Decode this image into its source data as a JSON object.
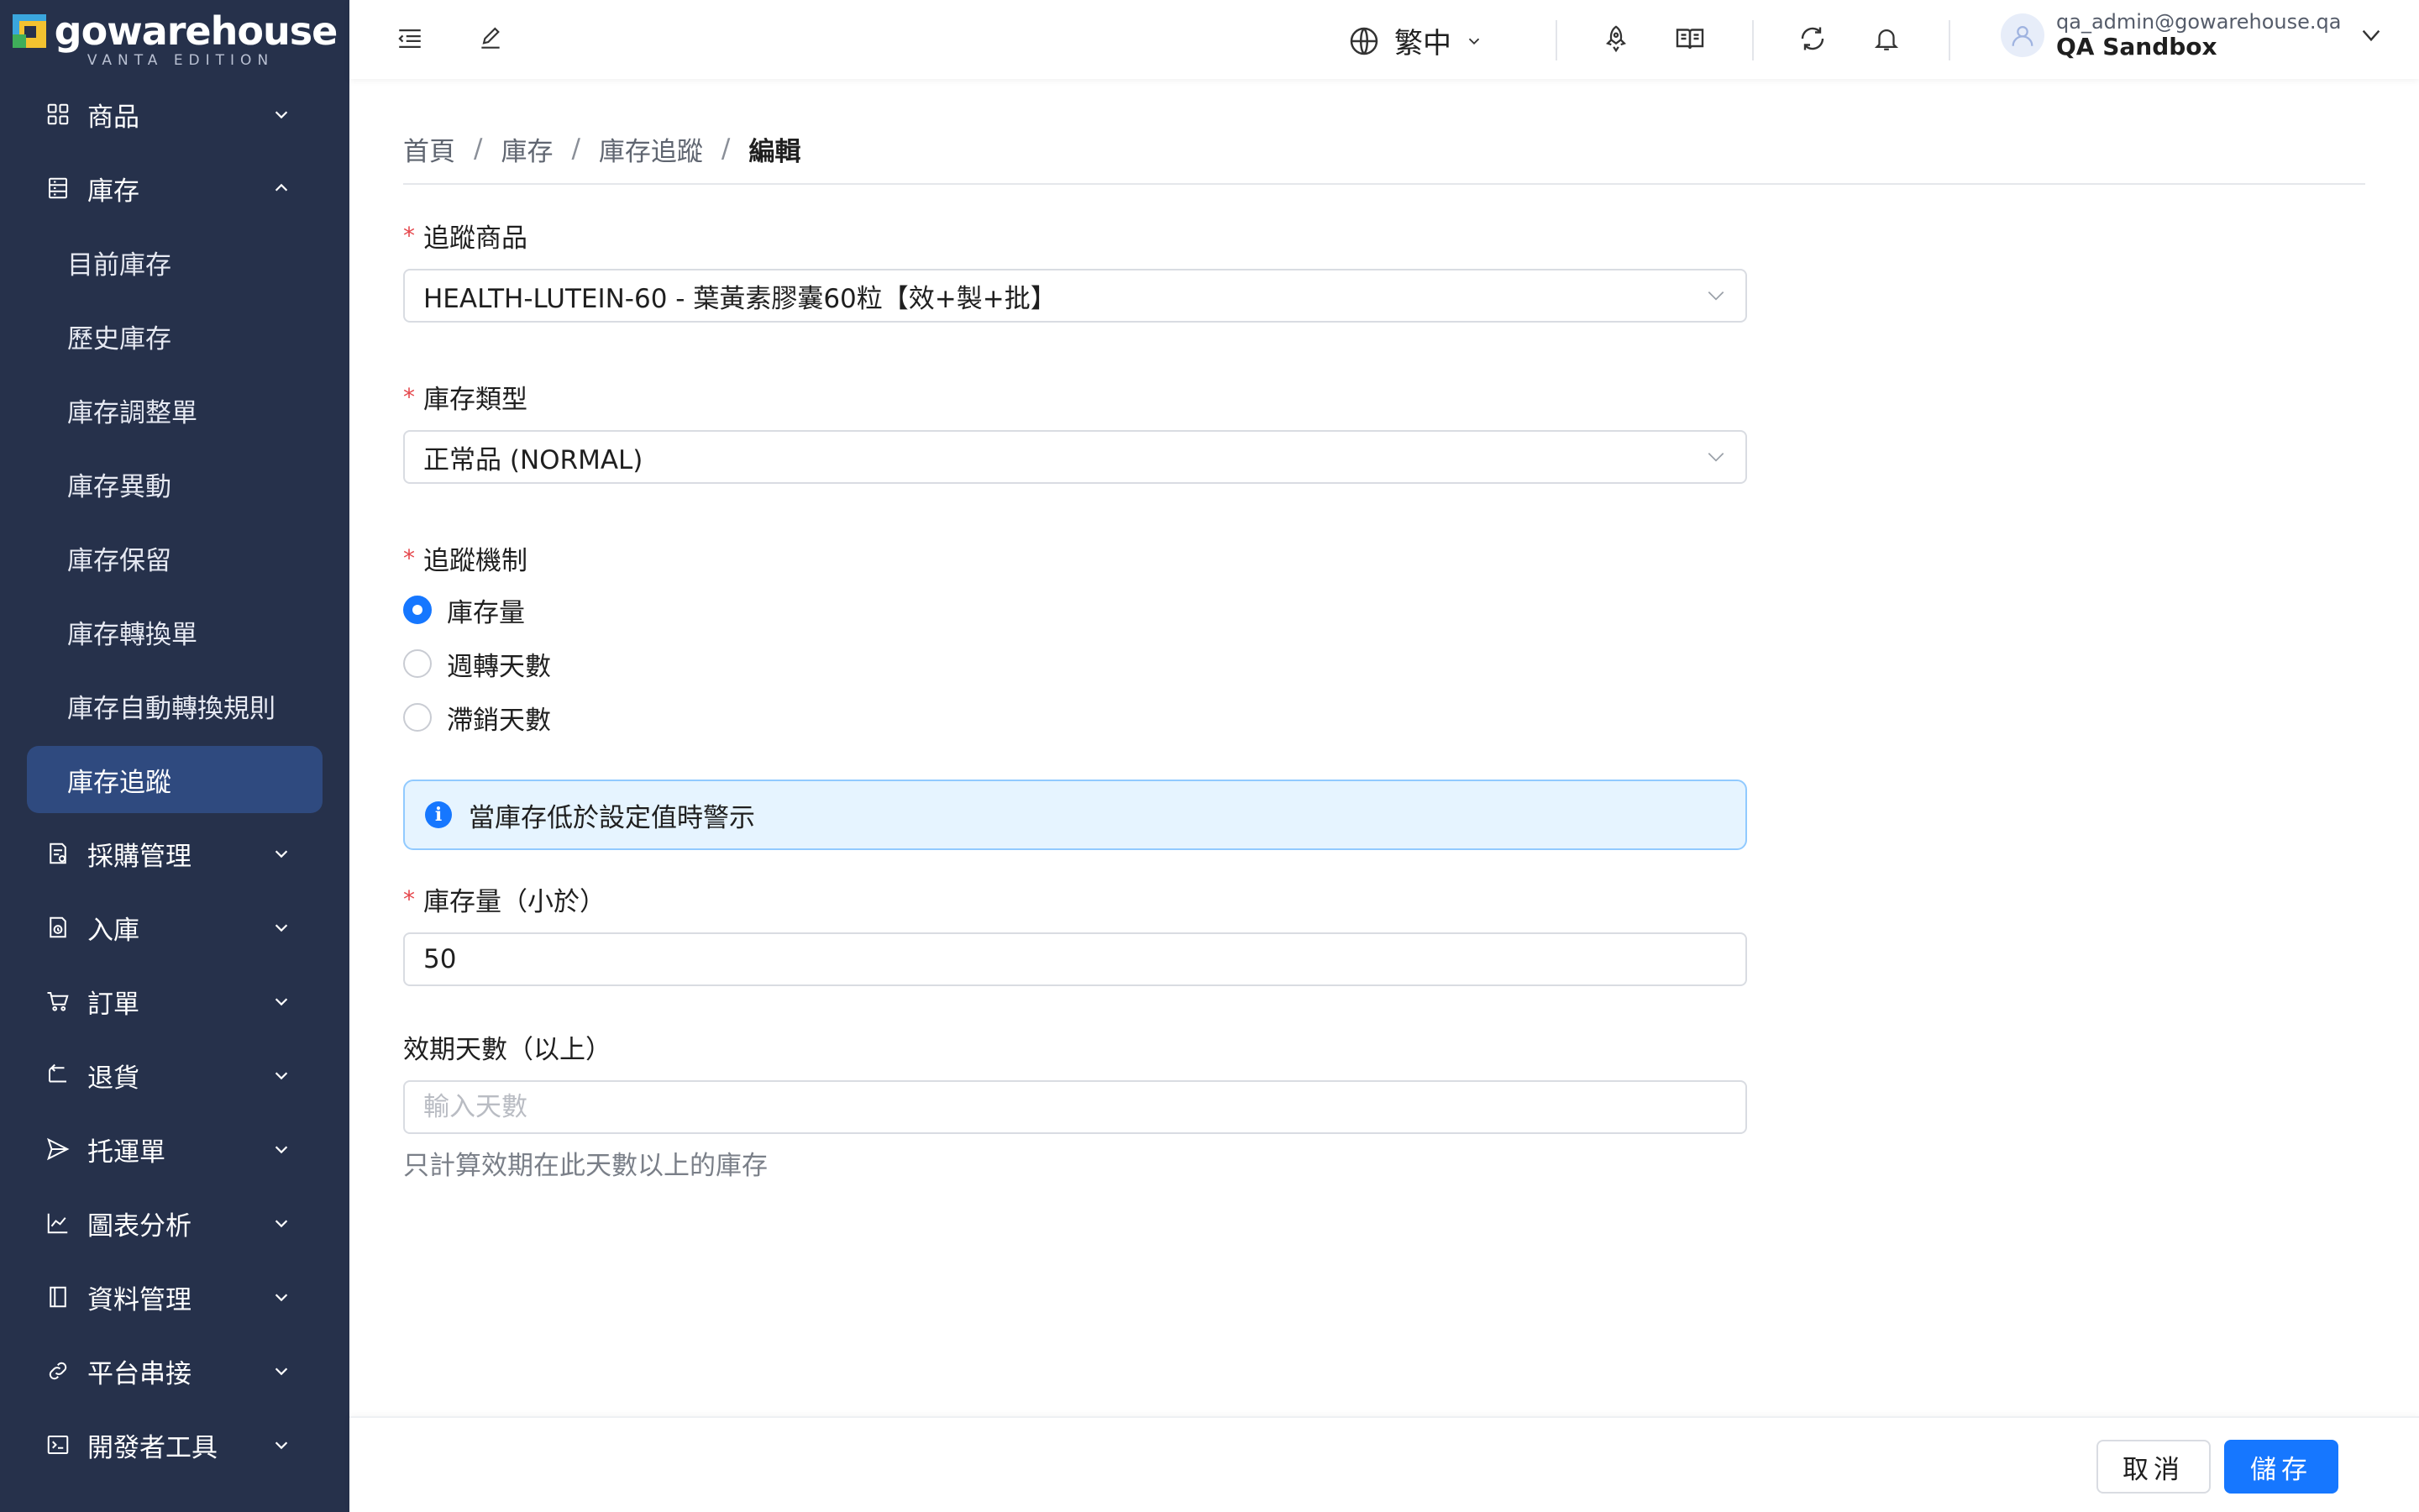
{
  "brand": {
    "name": "gowarehouse",
    "edition": "VANTA EDITION"
  },
  "sidebar": {
    "items": [
      {
        "label": "商品",
        "icon": "grid-icon",
        "expanded": false
      },
      {
        "label": "庫存",
        "icon": "inventory-icon",
        "expanded": true,
        "children": [
          {
            "label": "目前庫存"
          },
          {
            "label": "歷史庫存"
          },
          {
            "label": "庫存調整單"
          },
          {
            "label": "庫存異動"
          },
          {
            "label": "庫存保留"
          },
          {
            "label": "庫存轉換單"
          },
          {
            "label": "庫存自動轉換規則"
          },
          {
            "label": "庫存追蹤",
            "active": true
          }
        ]
      },
      {
        "label": "採購管理",
        "icon": "purchase-icon",
        "expanded": false
      },
      {
        "label": "入庫",
        "icon": "inbound-icon",
        "expanded": false
      },
      {
        "label": "訂單",
        "icon": "cart-icon",
        "expanded": false
      },
      {
        "label": "退貨",
        "icon": "return-icon",
        "expanded": false
      },
      {
        "label": "托運單",
        "icon": "send-icon",
        "expanded": false
      },
      {
        "label": "圖表分析",
        "icon": "line-chart-icon",
        "expanded": false
      },
      {
        "label": "資料管理",
        "icon": "book-icon",
        "expanded": false
      },
      {
        "label": "平台串接",
        "icon": "link-icon",
        "expanded": false
      },
      {
        "label": "開發者工具",
        "icon": "terminal-icon",
        "expanded": false
      }
    ]
  },
  "header": {
    "language": "繁中",
    "user": {
      "email": "qa_admin@gowarehouse.qa",
      "name": "QA Sandbox"
    }
  },
  "breadcrumb": [
    "首頁",
    "庫存",
    "庫存追蹤",
    "編輯"
  ],
  "form": {
    "product": {
      "label": "追蹤商品",
      "value": "HEALTH-LUTEIN-60 - 葉黃素膠囊60粒【效+製+批】"
    },
    "stock_type": {
      "label": "庫存類型",
      "value": "正常品 (NORMAL)"
    },
    "mechanism": {
      "label": "追蹤機制",
      "options": [
        "庫存量",
        "週轉天數",
        "滯銷天數"
      ],
      "selected": 0
    },
    "alert": "當庫存低於設定值時警示",
    "threshold": {
      "label": "庫存量（小於）",
      "value": "50"
    },
    "expiry_days": {
      "label": "效期天數（以上）",
      "placeholder": "輸入天數",
      "help": "只計算效期在此天數以上的庫存"
    }
  },
  "footer": {
    "cancel": "取消",
    "save": "儲存"
  },
  "colors": {
    "sidebar_bg": "#26314b",
    "active_bg": "#2f4a7f",
    "primary": "#1677ff",
    "required": "#e5484d"
  }
}
